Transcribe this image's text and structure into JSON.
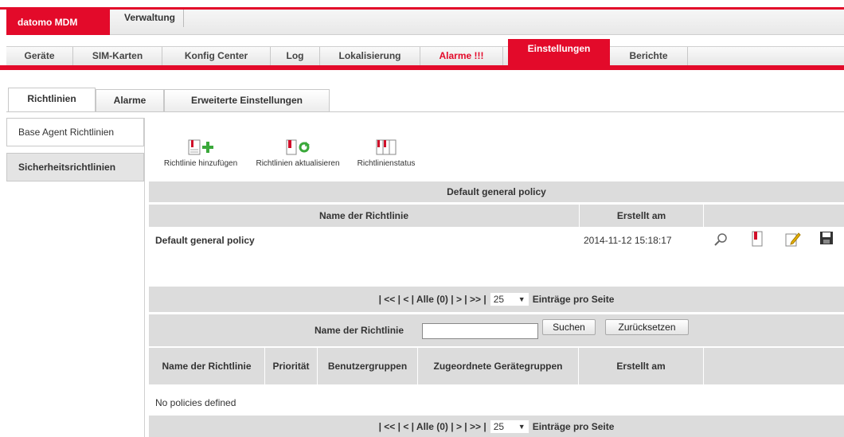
{
  "app": {
    "brand": "datomo MDM",
    "top_tab": "Verwaltung"
  },
  "nav": {
    "items": [
      "Geräte",
      "SIM-Karten",
      "Konfig Center",
      "Log",
      "Lokalisierung",
      "Alarme !!!",
      "Einstellungen",
      "Berichte"
    ],
    "active": "Einstellungen"
  },
  "subtabs": [
    "Richtlinien",
    "Alarme",
    "Erweiterte Einstellungen"
  ],
  "side": {
    "items": [
      "Base Agent Richtlinien",
      "Sicherheitsrichtlinien"
    ]
  },
  "toolbar": {
    "add": "Richtlinie hinzufügen",
    "refresh": "Richtlinien aktualisieren",
    "status": "Richtlinienstatus"
  },
  "default_section": {
    "title": "Default general policy",
    "headers": [
      "Name der Richtlinie",
      "Erstellt am"
    ],
    "row": {
      "name": "Default general policy",
      "created": "2014-11-12 15:18:17"
    }
  },
  "pager": {
    "text": "| << | < | Alle (0) | > | >> |",
    "per_page": "25",
    "suffix": "Einträge pro Seite"
  },
  "search": {
    "label": "Name der Richtlinie",
    "value": "",
    "search_btn": "Suchen",
    "reset_btn": "Zurücksetzen"
  },
  "policy_table": {
    "headers": [
      "Name der Richtlinie",
      "Priorität",
      "Benutzergruppen",
      "Zugeordnete Gerätegruppen",
      "Erstellt am"
    ],
    "empty": "No policies defined"
  },
  "colors": {
    "accent": "#e30a2a",
    "header_bg": "#dcdcdc"
  }
}
